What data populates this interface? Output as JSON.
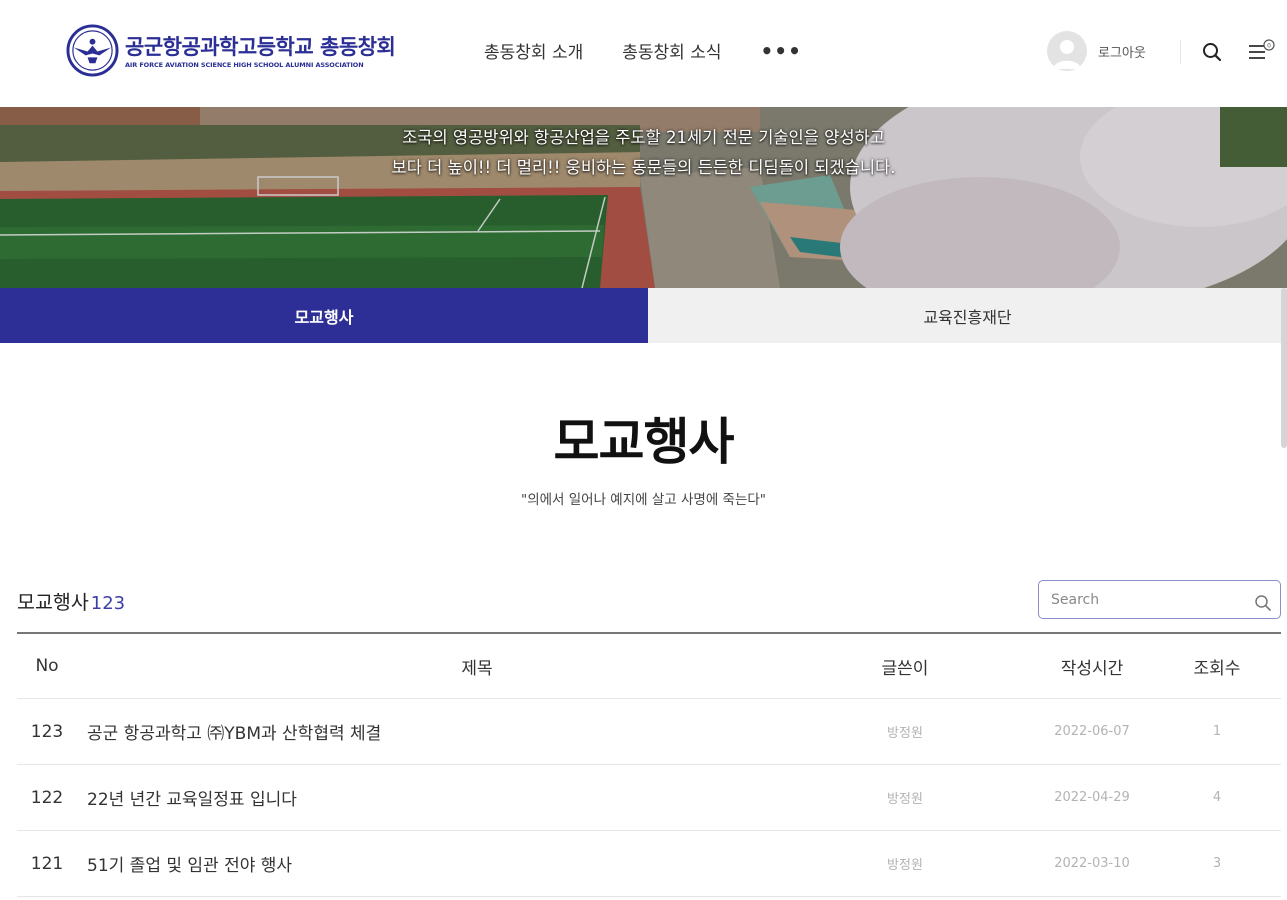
{
  "header": {
    "logo_title": "공군항공과학고등학교 총동창회",
    "logo_subtitle": "AIR FORCE AVIATION SCIENCE HIGH SCHOOL ALUMNI ASSOCIATION",
    "nav": [
      "총동창회 소개",
      "총동창회 소식"
    ],
    "nav_more": "•••",
    "logout_label": "로그아웃",
    "brand_color": "#2d2f96"
  },
  "banner": {
    "line1": "조국의 영공방위와 항공산업을 주도할 21세기 전문 기술인을 양성하고",
    "line2": "보다 더 높이!! 더 멀리!! 웅비하는 동문들의 든든한 디딤돌이 되겠습니다."
  },
  "tabs": [
    {
      "label": "모교행사",
      "active": true
    },
    {
      "label": "교육진흥재단",
      "active": false
    }
  ],
  "page": {
    "title": "모교행사",
    "subtitle": "\"의에서 일어나 예지에 살고 사명에 죽는다\""
  },
  "board": {
    "name": "모교행사",
    "count": "123",
    "search_placeholder": "Search",
    "columns": {
      "no": "No",
      "title": "제목",
      "author": "글쓴이",
      "date": "작성시간",
      "views": "조회수"
    },
    "rows": [
      {
        "no": "123",
        "title": "공군 항공과학고 ㈜YBM과 산학협력 체결",
        "author": "방정원",
        "date": "2022-06-07",
        "views": "1"
      },
      {
        "no": "122",
        "title": "22년 년간 교육일정표 입니다",
        "author": "방정원",
        "date": "2022-04-29",
        "views": "4"
      },
      {
        "no": "121",
        "title": "51기 졸업 및 임관 전야 행사",
        "author": "방정원",
        "date": "2022-03-10",
        "views": "3"
      }
    ]
  }
}
